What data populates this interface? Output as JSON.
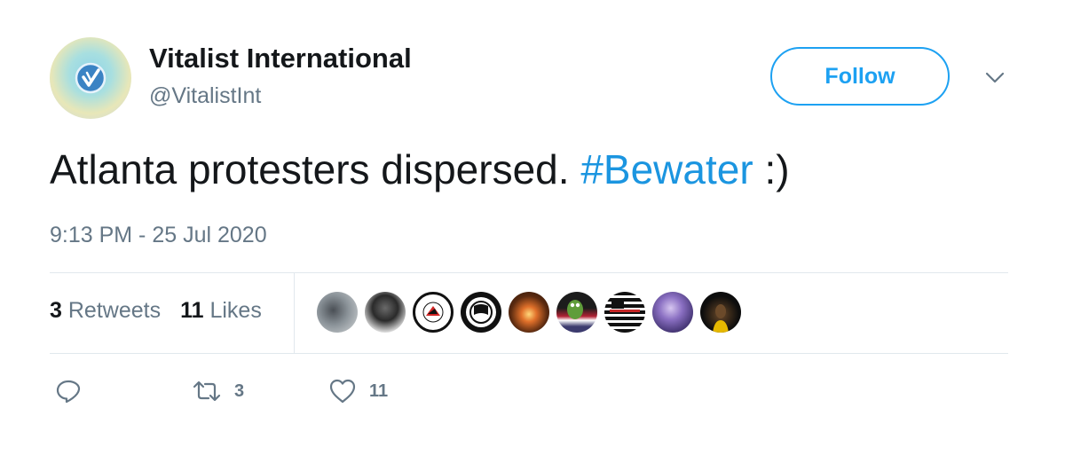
{
  "author": {
    "display_name": "Vitalist International",
    "handle": "@VitalistInt"
  },
  "follow_button": {
    "label": "Follow"
  },
  "tweet": {
    "text_before": "Atlanta protesters dispersed. ",
    "hashtag": "#Bewater",
    "text_after": " :)",
    "timestamp": "9:13 PM - 25 Jul 2020"
  },
  "stats": {
    "retweets_count": "3",
    "retweets_label": "Retweets",
    "likes_count": "11",
    "likes_label": "Likes"
  },
  "likers": [
    {
      "name": "liker-1",
      "color": "#9aa1a6"
    },
    {
      "name": "liker-2",
      "color": "#2d2d2d"
    },
    {
      "name": "liker-3",
      "color": "#ffffff"
    },
    {
      "name": "liker-4",
      "color": "#111111"
    },
    {
      "name": "liker-5",
      "color": "#5a2a10"
    },
    {
      "name": "liker-6",
      "color": "#3b6e2e"
    },
    {
      "name": "liker-7",
      "color": "#1a1a1a"
    },
    {
      "name": "liker-8",
      "color": "#5b4a8c"
    },
    {
      "name": "liker-9",
      "color": "#0d0d0d"
    }
  ],
  "actions": {
    "reply": {
      "icon": "reply-icon",
      "count": ""
    },
    "retweet": {
      "icon": "retweet-icon",
      "count": "3"
    },
    "like": {
      "icon": "heart-icon",
      "count": "11"
    }
  },
  "colors": {
    "accent": "#1da1f2",
    "hashtag": "#1b95e0",
    "secondary_text": "#657786",
    "primary_text": "#14171a",
    "divider": "#e1e8ed"
  }
}
